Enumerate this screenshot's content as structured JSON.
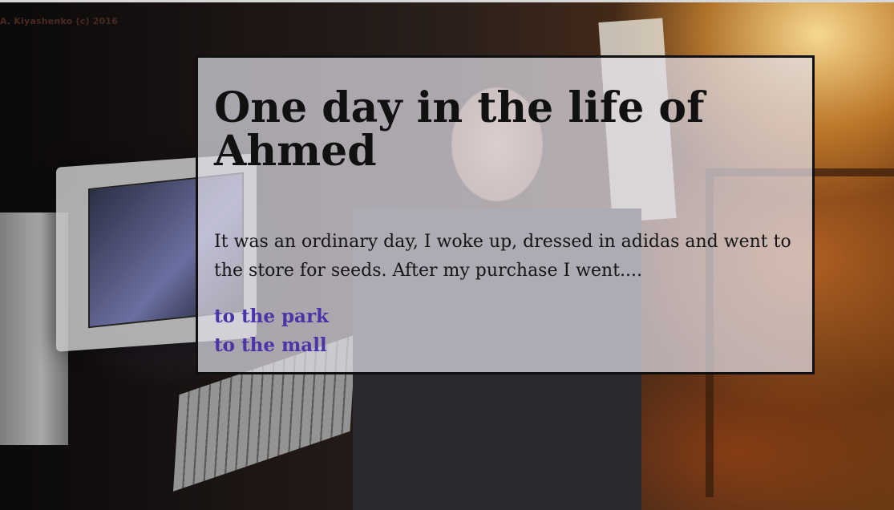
{
  "watermark": "A. Kiyashenko (c) 2016",
  "story": {
    "title": "One day in the life of Ahmed",
    "text": "It was an ordinary day, I woke up, dressed in adidas and went to the store for seeds. After my purchase I went....",
    "choices": [
      {
        "label": "to the park"
      },
      {
        "label": "to the mall"
      }
    ]
  },
  "colors": {
    "link": "#4a34a8",
    "panel_border": "#101010",
    "title": "#111111"
  }
}
